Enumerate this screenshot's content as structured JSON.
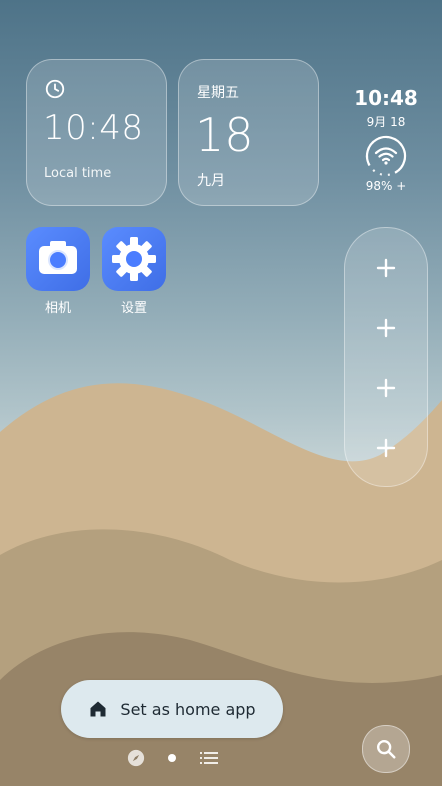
{
  "clock_widget": {
    "time": "10:48",
    "label": "Local time",
    "icon": "clock-icon"
  },
  "date_widget": {
    "weekday": "星期五",
    "day": "18",
    "month": "九月"
  },
  "status_widget": {
    "time": "10:48",
    "date": "9月 18",
    "battery": "98% +",
    "icon": "wifi-icon"
  },
  "apps": [
    {
      "label": "相机",
      "icon": "camera-icon"
    },
    {
      "label": "设置",
      "icon": "gear-icon"
    }
  ],
  "dock_column": {
    "slots": [
      {
        "icon": "plus-icon"
      },
      {
        "icon": "plus-icon"
      },
      {
        "icon": "plus-icon"
      },
      {
        "icon": "plus-icon"
      }
    ]
  },
  "home_button": {
    "label": "Set as home app",
    "icon": "home-icon"
  },
  "search_button": {
    "icon": "search-icon"
  },
  "pager": {
    "items": [
      "compass-icon",
      "page-dot-icon",
      "list-icon"
    ]
  },
  "colors": {
    "sky_top": "#4e7388",
    "sky_bottom": "#c6d4d6",
    "sand_light": "#cdb591",
    "sand_mid": "#b19e7e",
    "sand_dark": "#93826a",
    "app_blue": "#4a7dff",
    "home_button_bg": "#dde9ee"
  }
}
